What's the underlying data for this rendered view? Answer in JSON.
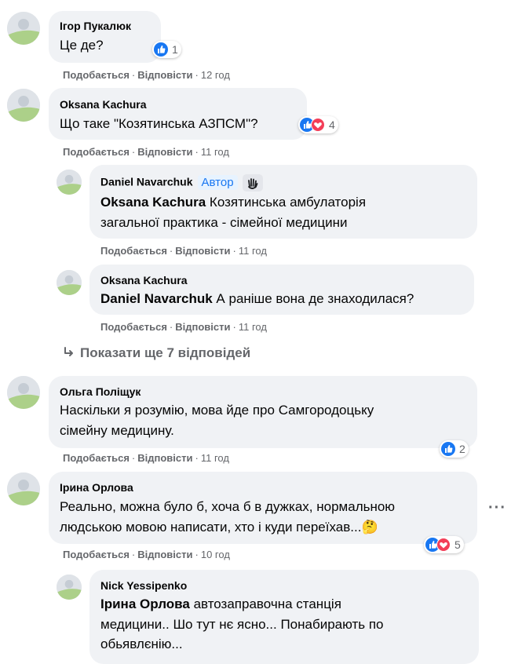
{
  "actions": {
    "like": "Подобається",
    "reply": "Відповісти",
    "sep": "·"
  },
  "comments": [
    {
      "name": "Ігор Пукалюк",
      "text": "Це де?",
      "time": "12 год",
      "reactions": "1"
    },
    {
      "name": "Oksana Kachura",
      "text": "Що таке \"Козятинська АЗПСМ\"?",
      "time": "11 год",
      "reactions": "4",
      "replies": [
        {
          "name": "Daniel Navarchuk",
          "badge": "Автор",
          "mention": "Oksana Kachura",
          "line1": "Козятинська амбулаторія",
          "line2": "загальної практика - сімейної медицини",
          "time": "11 год"
        },
        {
          "name": "Oksana Kachura",
          "mention": "Daniel Navarchuk",
          "line1": "А раніше вона де знаходилася?",
          "time": "11 год"
        }
      ],
      "more_replies": "Показати ще 7 відповідей"
    },
    {
      "name": "Ольга Поліщук",
      "line1": "Наскільки я розумію, мова йде про Самгородоцьку",
      "line2": "сімейну медицину.",
      "time": "11 год",
      "reactions": "2"
    },
    {
      "name": "Ірина Орлова",
      "line1": "Реально, можна було б, хоча б в дужках, нормальною",
      "line2": "людською мовою написати, хто і куди переїхав...",
      "emoji": "🤔",
      "time": "10 год",
      "reactions": "5",
      "replies": [
        {
          "name": "Nick Yessipenko",
          "mention": "Ірина Орлова",
          "line1": "автозаправочна станція",
          "line2": "медицини.. Шо тут нє ясно... Понабирають по",
          "line3": "обьявлєнію..."
        }
      ]
    }
  ],
  "icons": {
    "more": "more-options-icon",
    "reply_arrow": "reply-arrow-icon"
  }
}
